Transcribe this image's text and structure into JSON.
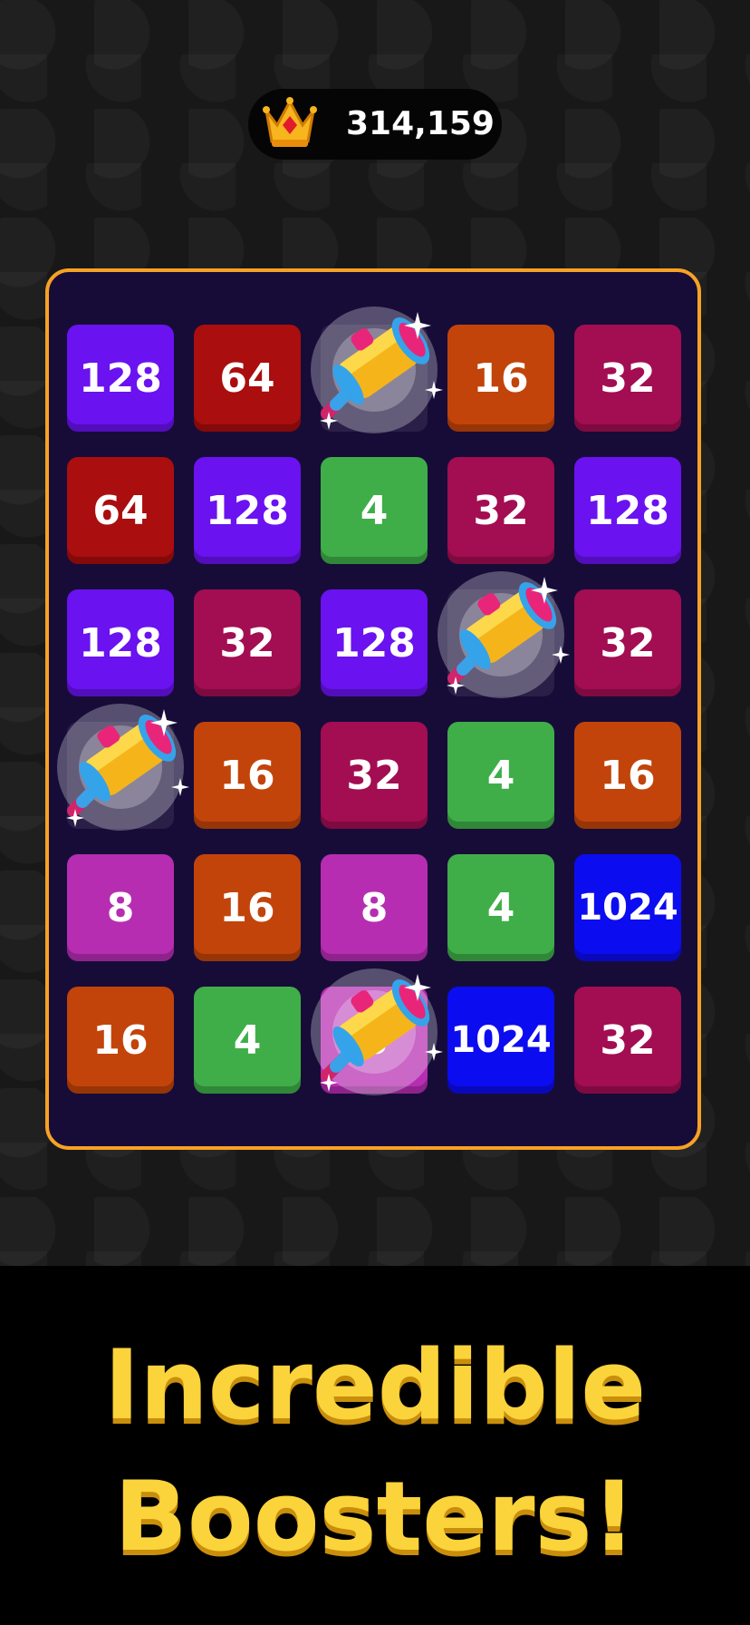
{
  "score": {
    "value": "314,159",
    "icon": "crown-icon"
  },
  "colors": {
    "4": "#3fae48",
    "8": "#b62db2",
    "16": "#c2440a",
    "32": "#a30d52",
    "64": "#aa0e0e",
    "128": "#6a12f0",
    "1024": "#0c0cf0",
    "board_border": "#f7a224",
    "caption": "#fbd33b"
  },
  "board": {
    "rows": [
      [
        "128",
        "64",
        "",
        "16",
        "32"
      ],
      [
        "64",
        "128",
        "4",
        "32",
        "128"
      ],
      [
        "128",
        "32",
        "128",
        "",
        "32"
      ],
      [
        "",
        "16",
        "32",
        "4",
        "16"
      ],
      [
        "8",
        "16",
        "8",
        "4",
        "1024"
      ],
      [
        "16",
        "4",
        "8",
        "1024",
        "32"
      ]
    ],
    "boosters": [
      {
        "name": "hammer-booster-icon",
        "row": 0,
        "col": 2
      },
      {
        "name": "hammer-booster-icon",
        "row": 2,
        "col": 3
      },
      {
        "name": "hammer-booster-icon",
        "row": 3,
        "col": 0
      },
      {
        "name": "hammer-booster-icon",
        "row": 5,
        "col": 2
      }
    ]
  },
  "caption": {
    "line1": "Incredible",
    "line2": "Boosters!"
  }
}
